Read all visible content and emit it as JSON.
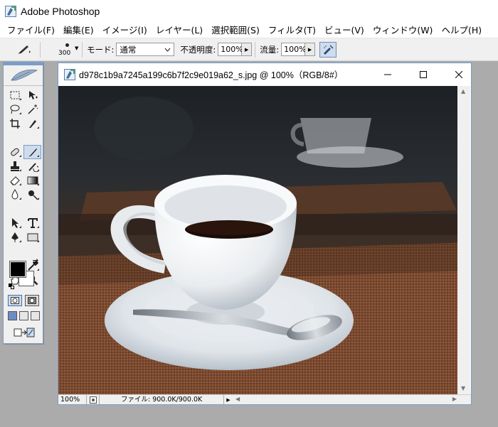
{
  "window": {
    "title": "Adobe Photoshop"
  },
  "menus": [
    "ファイル(F)",
    "編集(E)",
    "イメージ(I)",
    "レイヤー(L)",
    "選択範囲(S)",
    "フィルタ(T)",
    "ビュー(V)",
    "ウィンドウ(W)",
    "ヘルプ(H)"
  ],
  "options": {
    "brush_size": "300",
    "mode_label": "モード:",
    "mode_value": "通常",
    "opacity_label": "不透明度:",
    "opacity_value": "100%",
    "flow_label": "流量:",
    "flow_value": "100%"
  },
  "document": {
    "title": "d978c1b9a7245a199c6b7f2c9e019a62_s.jpg @ 100%（RGB/8#）",
    "zoom": "100%",
    "file_info": "ファイル: 900.0K/900.0K"
  },
  "colors": {
    "foreground": "#000000",
    "background": "#ffffff",
    "accent": "#7a9ec8"
  }
}
